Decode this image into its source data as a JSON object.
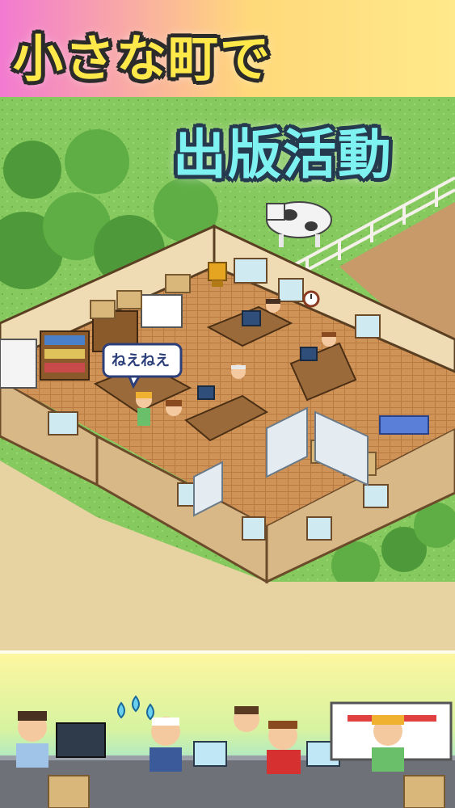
{
  "headline": {
    "line1": "小さな町で",
    "line2": "出版活動"
  },
  "speech_bubble": {
    "text": "ねえねえ"
  },
  "colors": {
    "headline1_fill": "#ffe94a",
    "headline2_fill": "#7ef2f0",
    "grass": "#7cc25a",
    "dirt_path": "#e9d6a4",
    "floor": "#c98d4f",
    "bottom_band_top": "#f6eb8e",
    "bottom_band_bottom": "#7fe0ff"
  },
  "icons": [
    "cow-icon",
    "fence-icon",
    "trophy-icon",
    "clock-icon",
    "computer-icon",
    "sweat-drops-icon"
  ]
}
